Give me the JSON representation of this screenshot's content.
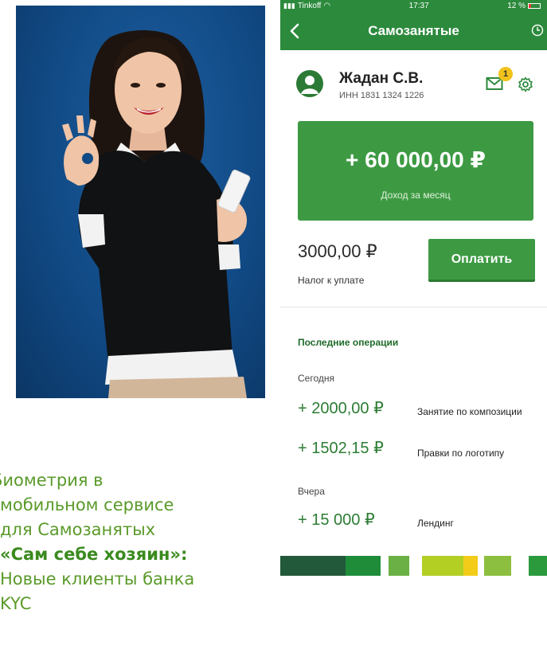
{
  "caption": {
    "lines": [
      "Биометрия в",
      "мобильном сервисе",
      "для Самозанятых"
    ],
    "highlight": "«Сам себе хозяин»:",
    "last_lines": [
      "Новые клиенты банка",
      "KYC"
    ]
  },
  "phone": {
    "status_bar": {
      "carrier": "Tinkoff",
      "time": "17:37",
      "battery": "12 %"
    },
    "nav": {
      "title": "Самозанятые",
      "back_icon": "chevron-left-icon",
      "history_icon": "clock-icon"
    },
    "profile": {
      "name": "Жадан С.В.",
      "inn": "ИНН 1831 1324 1226",
      "unread_count": "1"
    },
    "income": {
      "amount": "+ 60 000,00 ₽",
      "label": "Доход за месяц"
    },
    "tax": {
      "amount": "3000,00 ₽",
      "label": "Налог к уплате",
      "pay_label": "Оплатить"
    },
    "operations": {
      "title": "Последние операции",
      "groups": [
        {
          "day": "Сегодня",
          "items": [
            {
              "amount": "+ 2000,00 ₽",
              "desc": "Занятие по композиции"
            },
            {
              "amount": "+ 1502,15 ₽",
              "desc": "Правки по логотипу"
            }
          ]
        },
        {
          "day": "Вчера",
          "items": [
            {
              "amount": "+ 15 000 ₽",
              "desc": "Лендинг"
            }
          ]
        }
      ]
    }
  },
  "colors": {
    "brand_green": "#3d9a43",
    "nav_green": "#2c8a3c",
    "badge_yellow": "#f2c21c",
    "stripe": [
      "#22593a",
      "#1f8c3a",
      "#6ab044",
      "#b3cf24",
      "#f3cc19",
      "#8cbf3f",
      "#2b9a3d"
    ]
  }
}
